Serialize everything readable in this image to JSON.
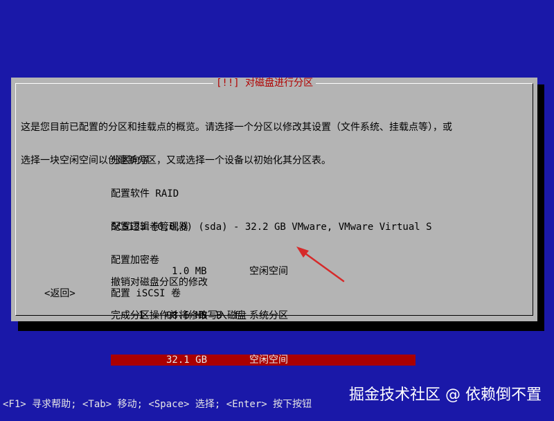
{
  "dialog": {
    "title": "[!!] 对磁盘进行分区",
    "description_line1": "这是您目前已配置的分区和挂载点的概览。请选择一个分区以修改其设置（文件系统、挂载点等），或",
    "description_line2": "选择一块空闲空间以创建新分区，又或选择一个设备以初始化其分区表。"
  },
  "menu": {
    "items": [
      "分区向导",
      "配置软件 RAID",
      "配置逻辑卷管理器",
      "配置加密卷",
      "配置 iSCSI 卷"
    ]
  },
  "disk": {
    "header": "SCSI33 (0,0,0) (sda) - 32.2 GB VMware, VMware Virtual S",
    "partitions": [
      {
        "num": "",
        "size": "1.0 MB",
        "flags": "",
        "type": "空闲空间",
        "selected": false
      },
      {
        "num": "1",
        "size": "98.6 MB",
        "flags": "B  f",
        "type": "系统分区",
        "selected": false
      },
      {
        "num": "",
        "size": "32.1 GB",
        "flags": "",
        "type": "空闲空间",
        "selected": true
      }
    ]
  },
  "actions": {
    "undo": "撤销对磁盘分区的修改",
    "finish": "完成分区操作并将修改写入磁盘"
  },
  "back_label": "<返回>",
  "footer_text": "<F1> 寻求帮助; <Tab> 移动; <Space> 选择; <Enter> 按下按钮",
  "watermark": "掘金技术社区 @ 依赖倒不置",
  "colors": {
    "background": "#1a18a8",
    "dialog": "#b4b4b4",
    "selection": "#aa0000",
    "title": "#b00000",
    "arrow": "#d62a2a"
  }
}
